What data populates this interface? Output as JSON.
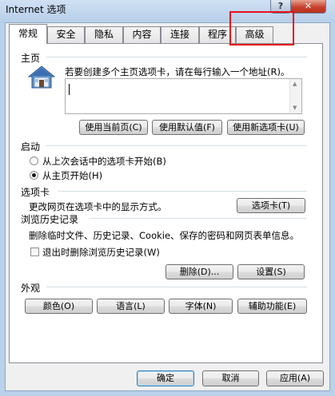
{
  "window": {
    "title": "Internet 选项",
    "help_label": "?",
    "close_label": "✕"
  },
  "tabs": [
    {
      "label": "常规",
      "active": true
    },
    {
      "label": "安全"
    },
    {
      "label": "隐私"
    },
    {
      "label": "内容"
    },
    {
      "label": "连接"
    },
    {
      "label": "程序"
    },
    {
      "label": "高级"
    }
  ],
  "home": {
    "title": "主页",
    "instruction": "若要创建多个主页选项卡，请在每行输入一个地址(R)。",
    "url_value": "",
    "use_current": "使用当前页(C)",
    "use_default": "使用默认值(F)",
    "use_new_tab": "使用新选项卡(U)"
  },
  "startup": {
    "title": "启动",
    "option_last_session": "从上次会话中的选项卡开始(B)",
    "option_home": "从主页开始(H)",
    "selected": "option_home"
  },
  "tabs_section": {
    "title": "选项卡",
    "description": "更改网页在选项卡中的显示方式。",
    "button": "选项卡(T)"
  },
  "history": {
    "title": "浏览历史记录",
    "description": "删除临时文件、历史记录、Cookie、保存的密码和网页表单信息。",
    "delete_on_exit_label": "退出时删除浏览历史记录(W)",
    "delete_on_exit_checked": false,
    "delete_button": "删除(D)...",
    "settings_button": "设置(S)"
  },
  "appearance": {
    "title": "外观",
    "colors": "颜色(O)",
    "languages": "语言(L)",
    "fonts": "字体(N)",
    "accessibility": "辅助功能(E)"
  },
  "footer": {
    "ok": "确定",
    "cancel": "取消",
    "apply": "应用(A)"
  },
  "colors": {
    "highlight_box": "#e8101a",
    "title_bar": "#b9d1ea",
    "close_button": "#c8432f"
  }
}
